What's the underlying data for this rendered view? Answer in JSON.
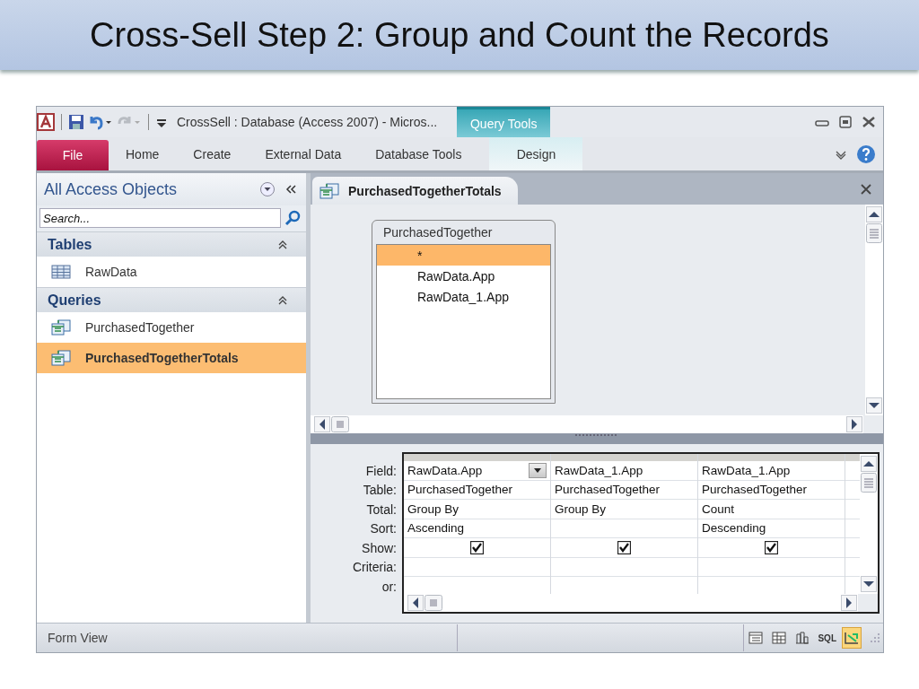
{
  "slide": {
    "title": "Cross-Sell Step 2: Group and Count the Records"
  },
  "window": {
    "title": "CrossSell : Database (Access 2007)  -  Micros...",
    "contextual_group": "Query Tools"
  },
  "ribbon_tabs": [
    {
      "label": "File",
      "kind": "file"
    },
    {
      "label": "Home",
      "kind": "normal"
    },
    {
      "label": "Create",
      "kind": "normal"
    },
    {
      "label": "External Data",
      "kind": "normal"
    },
    {
      "label": "Database Tools",
      "kind": "normal"
    },
    {
      "label": "Design",
      "kind": "contextual"
    }
  ],
  "navigation_pane": {
    "title": "All Access Objects",
    "search": {
      "placeholder": "Search..."
    },
    "groups": [
      {
        "label": "Tables",
        "items": [
          {
            "label": "RawData",
            "kind": "table",
            "selected": false
          }
        ]
      },
      {
        "label": "Queries",
        "items": [
          {
            "label": "PurchasedTogether",
            "kind": "query",
            "selected": false
          },
          {
            "label": "PurchasedTogetherTotals",
            "kind": "query",
            "selected": true
          }
        ]
      }
    ]
  },
  "document_tab": {
    "label": "PurchasedTogetherTotals"
  },
  "table_box": {
    "title": "PurchasedTogether",
    "fields": [
      {
        "label": "*",
        "selected": true
      },
      {
        "label": "RawData.App",
        "selected": false
      },
      {
        "label": "RawData_1.App",
        "selected": false
      }
    ]
  },
  "design_grid": {
    "row_labels": [
      "Field:",
      "Table:",
      "Total:",
      "Sort:",
      "Show:",
      "Criteria:",
      "or:"
    ],
    "columns": [
      {
        "field": "RawData.App",
        "table": "PurchasedTogether",
        "total": "Group By",
        "sort": "Ascending",
        "show": true,
        "active": true
      },
      {
        "field": "RawData_1.App",
        "table": "PurchasedTogether",
        "total": "Group By",
        "show": true,
        "active": false
      },
      {
        "field": "RawData_1.App",
        "table": "PurchasedTogether",
        "total": "Count",
        "sort": "Descending",
        "show": true,
        "active": false
      }
    ]
  },
  "status_bar": {
    "text": "Form View",
    "view_buttons": [
      {
        "kind": "datasheet",
        "selected": false
      },
      {
        "kind": "pivot-table",
        "selected": false
      },
      {
        "kind": "pivot-chart",
        "selected": false
      },
      {
        "kind": "sql",
        "label": "SQL",
        "selected": false
      },
      {
        "kind": "design",
        "selected": true
      }
    ]
  }
}
